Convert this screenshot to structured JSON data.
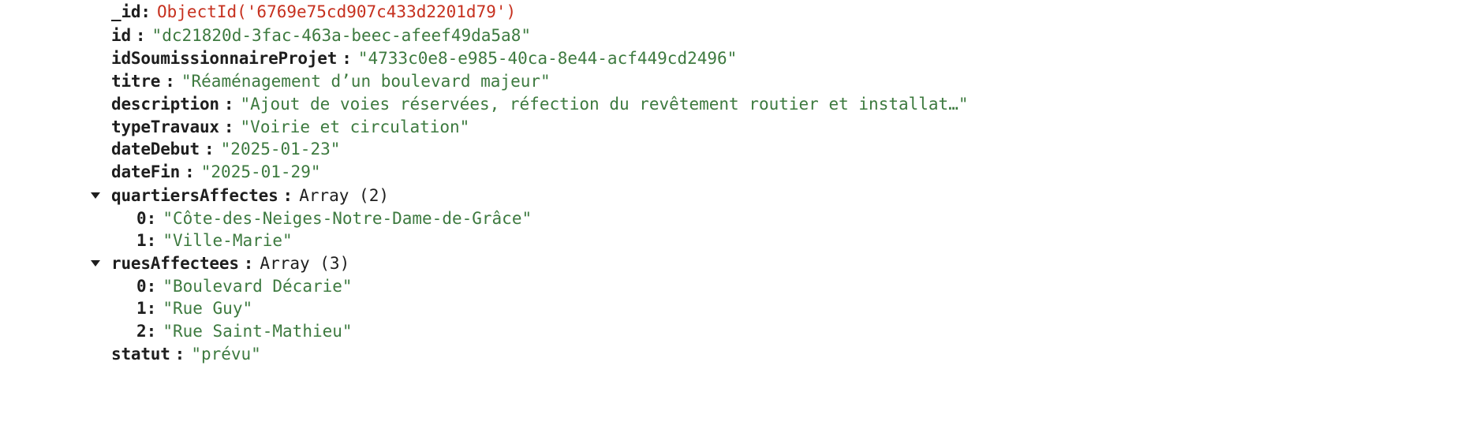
{
  "document": {
    "fields": [
      {
        "key": "_id",
        "value": "ObjectId('6769e75cd907c433d2201d79')",
        "kind": "objectid"
      },
      {
        "key": "id",
        "value": "\"dc21820d-3fac-463a-beec-afeef49da5a8\"",
        "kind": "string"
      },
      {
        "key": "idSoumissionnaireProjet",
        "value": "\"4733c0e8-e985-40ca-8e44-acf449cd2496\"",
        "kind": "string"
      },
      {
        "key": "titre",
        "value": "\"Réaménagement d’un boulevard majeur\"",
        "kind": "string"
      },
      {
        "key": "description",
        "value": "\"Ajout de voies réservées, réfection du revêtement routier et installat…\"",
        "kind": "string"
      },
      {
        "key": "typeTravaux",
        "value": "\"Voirie et circulation\"",
        "kind": "string"
      },
      {
        "key": "dateDebut",
        "value": "\"2025-01-23\"",
        "kind": "string"
      },
      {
        "key": "dateFin",
        "value": "\"2025-01-29\"",
        "kind": "string"
      }
    ],
    "quartiers": {
      "key": "quartiersAffectes",
      "meta": "Array (2)",
      "items": [
        {
          "index": "0",
          "value": "\"Côte-des-Neiges-Notre-Dame-de-Grâce\""
        },
        {
          "index": "1",
          "value": "\"Ville-Marie\""
        }
      ]
    },
    "rues": {
      "key": "ruesAffectees",
      "meta": "Array (3)",
      "items": [
        {
          "index": "0",
          "value": "\"Boulevard Décarie\""
        },
        {
          "index": "1",
          "value": "\"Rue Guy\""
        },
        {
          "index": "2",
          "value": "\"Rue Saint-Mathieu\""
        }
      ]
    },
    "statut": {
      "key": "statut",
      "value": "\"prévu\""
    }
  },
  "colors": {
    "string": "#3d7a3f",
    "objectid": "#c6301e",
    "key": "#1e1e1e"
  }
}
